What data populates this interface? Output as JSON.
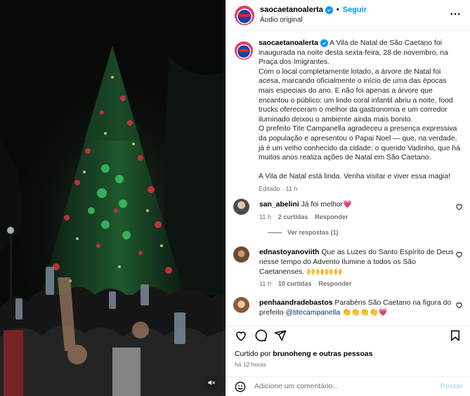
{
  "header": {
    "username": "saocaetanoalerta",
    "follow_label": "Seguir",
    "audio_label": "Áudio original"
  },
  "caption": {
    "username": "saocaetanoalerta",
    "p1": "A Vila de Natal de São Caetano foi inaugurada na noite desta sexta-feira, 28 de novembro, na Praça dos Imigrantes.",
    "p2": "Com o local completamente lotado, a árvore de Natal foi acesa, marcando oficialmente o início de uma das épocas mais especiais do ano. E não foi apenas a árvore que encantou o público: um lindo coral infantil abriu a noite, food trucks ofereceram o melhor da gastronomia e um corredor iluminado deixou o ambiente ainda mais bonito.",
    "p3": "O prefeito Tite Campanella agradeceu a presença expressiva da população e apresentou o Papai Noel — que, na verdade, já é um velho conhecido da cidade: o querido Vadinho, que há muitos anos realiza ações de Natal em São Caetano.",
    "p4": "A Vila de Natal está linda. Venha visitar e viver essa magia!",
    "meta": "Editado · 11 h"
  },
  "comments": [
    {
      "username": "san_abelini",
      "text": "Já foi melhor💗",
      "time": "11 h",
      "likes": "2 curtidas",
      "reply": "Responder",
      "view_replies": "Ver respostas (1)"
    },
    {
      "username": "ednastoyanoviith",
      "text": "Que as Luzes do Santo Espírito de Deus nesse tempo do Advento Ilumine a todos os São Caetanenses. 🙌🙌🙌🙌",
      "time": "11 h",
      "likes": "10 curtidas",
      "reply": "Responder"
    },
    {
      "username": "penhaandradebastos",
      "text_pre": "Parabéns São Caetano na figura do prefeito ",
      "mention": "@titecampanella",
      "text_post": " 👏👏👏👏💗"
    }
  ],
  "likes_summary": {
    "prefix": "Curtido por ",
    "user": "brunoheng",
    "suffix": " e outras pessoas"
  },
  "time_ago": "há 12 horas",
  "add_comment": {
    "placeholder": "Adicione um comentário...",
    "post_label": "Postar"
  },
  "colors": {
    "accent": "#0095f6",
    "mention": "#00376b",
    "muted": "#737373",
    "heart_red": "#ed4956"
  }
}
